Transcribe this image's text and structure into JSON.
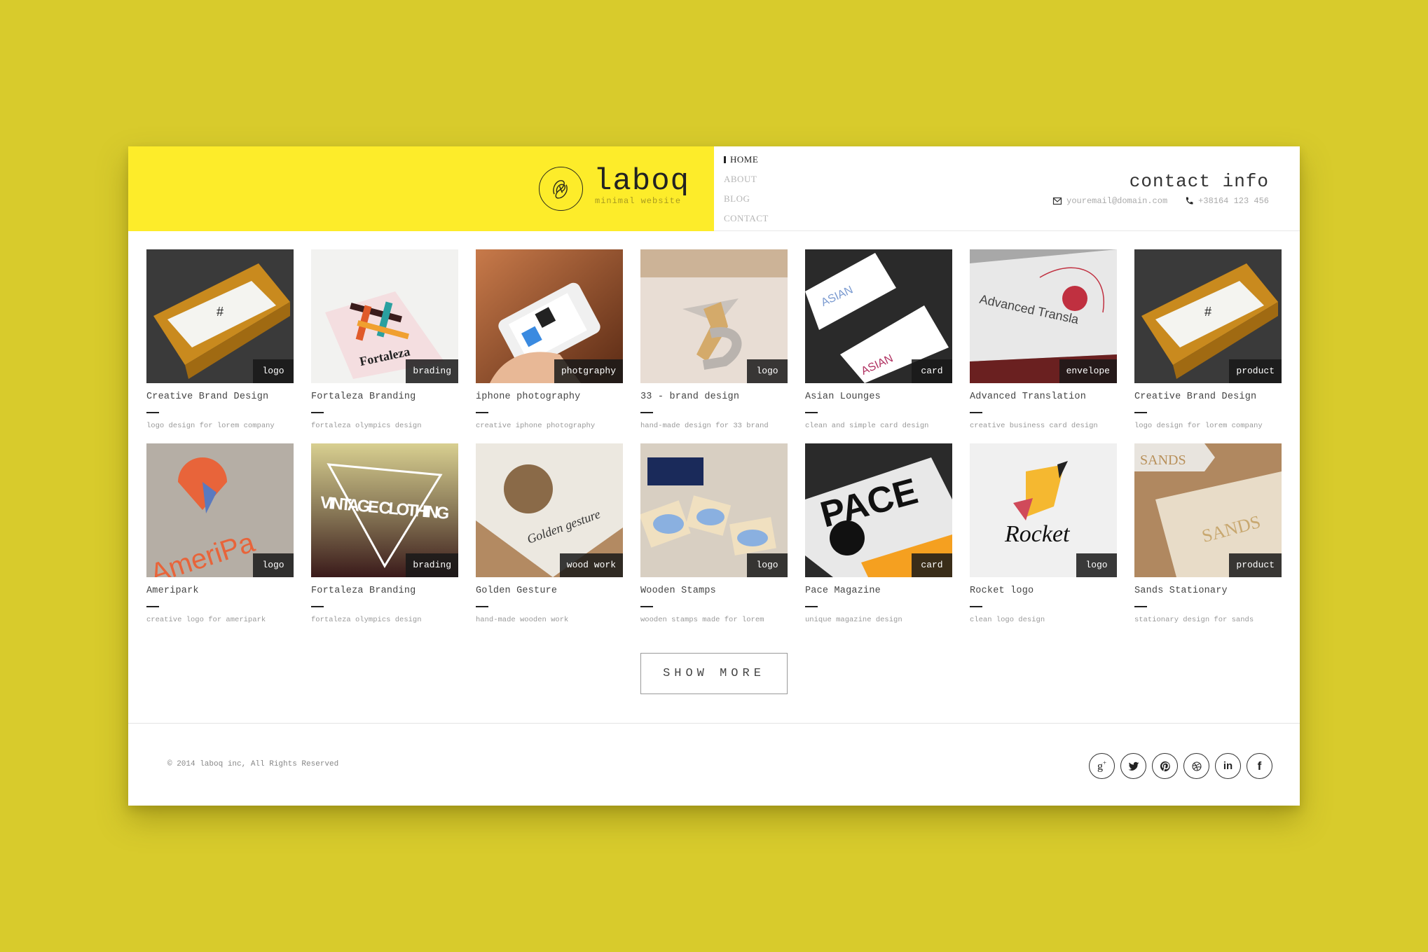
{
  "header": {
    "logo_text": "laboq",
    "logo_tagline": "minimal website",
    "brand_color": "#fdec2a",
    "nav": [
      {
        "label": "HOME",
        "active": true
      },
      {
        "label": "ABOUT",
        "active": false
      },
      {
        "label": "BLOG",
        "active": false
      },
      {
        "label": "CONTACT",
        "active": false
      }
    ],
    "contact_title": "contact info",
    "email": "youremail@domain.com",
    "phone": "+38164 123 456",
    "email_icon": "envelope-icon",
    "phone_icon": "phone-icon"
  },
  "portfolio": [
    {
      "title": "Creative Brand Design",
      "tag": "logo",
      "desc": "logo design for lorem company"
    },
    {
      "title": "Fortaleza Branding",
      "tag": "brading",
      "desc": "fortaleza olympics design"
    },
    {
      "title": "iphone photography",
      "tag": "photgraphy",
      "desc": "creative iphone photography"
    },
    {
      "title": "33 - brand design",
      "tag": "logo",
      "desc": "hand-made design for 33 brand"
    },
    {
      "title": "Asian Lounges",
      "tag": "card",
      "desc": "clean and simple card design"
    },
    {
      "title": "Advanced Translation",
      "tag": "envelope",
      "desc": "creative business card design"
    },
    {
      "title": "Creative Brand Design",
      "tag": "product",
      "desc": "logo design for lorem company"
    },
    {
      "title": "Ameripark",
      "tag": "logo",
      "desc": "creative logo for ameripark"
    },
    {
      "title": "Fortaleza Branding",
      "tag": "brading",
      "desc": "fortaleza olympics design"
    },
    {
      "title": "Golden Gesture",
      "tag": "wood work",
      "desc": "hand-made wooden work"
    },
    {
      "title": "Wooden Stamps",
      "tag": "logo",
      "desc": "wooden stamps made for lorem"
    },
    {
      "title": "Pace Magazine",
      "tag": "card",
      "desc": "unique magazine design"
    },
    {
      "title": "Rocket logo",
      "tag": "logo",
      "desc": "clean logo design"
    },
    {
      "title": "Sands Stationary",
      "tag": "product",
      "desc": "stationary design for sands"
    }
  ],
  "thumb_text": {
    "fortaleza": "Fortaleza",
    "asian": "ASIAN",
    "advanced": "Advanced Transla",
    "ameri": "AmeriPa",
    "vintage": "VINTAGE CLOTHING",
    "golden": "Golden gesture",
    "pace": "PACE",
    "rocket": "Rocket",
    "sands": "SANDS"
  },
  "show_more_label": "SHOW MORE",
  "footer": {
    "copyright": "© 2014 laboq inc, All Rights Reserved",
    "social": [
      {
        "name": "google-plus-icon",
        "glyph": "g+"
      },
      {
        "name": "twitter-icon",
        "glyph": "t"
      },
      {
        "name": "pinterest-icon",
        "glyph": "p"
      },
      {
        "name": "dribbble-icon",
        "glyph": "d"
      },
      {
        "name": "linkedin-icon",
        "glyph": "in"
      },
      {
        "name": "facebook-icon",
        "glyph": "f"
      }
    ]
  }
}
